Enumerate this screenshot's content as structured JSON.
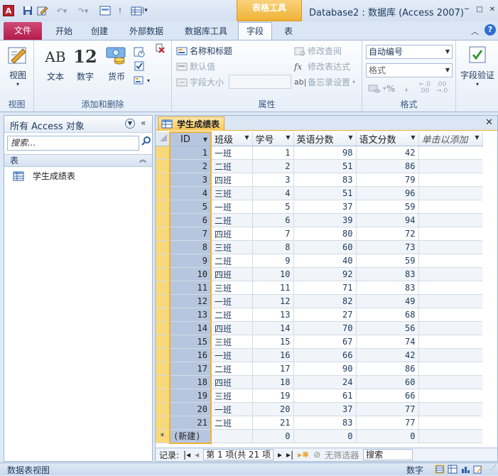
{
  "window": {
    "context_tab": "表格工具",
    "title": "Database2 : 数据库 (Access 2007)",
    "app_icon": "A",
    "controls": [
      "─",
      "□",
      "✕"
    ]
  },
  "ribbon_tabs": {
    "file": "文件",
    "items": [
      "开始",
      "创建",
      "外部数据",
      "数据库工具",
      "字段",
      "表"
    ],
    "active": "字段"
  },
  "ribbon": {
    "view": {
      "label": "视图",
      "group": "视图"
    },
    "add_delete": {
      "group": "添加和删除",
      "text": "文本",
      "number": "数字",
      "currency": "货币",
      "icon_text": "AB",
      "icon_number": "12"
    },
    "properties": {
      "group": "属性",
      "name_caption": "名称和标题",
      "default_value": "默认值",
      "field_size": "字段大小",
      "modify_lookups": "修改查阅",
      "modify_expression": "修改表达式",
      "memo_settings": "备忘录设置"
    },
    "format": {
      "group": "格式",
      "data_type": "自动编号",
      "format_value": "格式",
      "percent": "%",
      "comma": ",",
      "inc_decimal": "←.0 .00",
      "dec_decimal": ".00 →.0"
    },
    "validation": {
      "label": "字段验证"
    }
  },
  "nav_pane": {
    "header": "所有 Access 对象",
    "search_placeholder": "搜索...",
    "section": "表",
    "items": [
      "学生成绩表"
    ]
  },
  "document": {
    "tab_title": "学生成绩表",
    "columns": [
      "ID",
      "班级",
      "学号",
      "英语分数",
      "语文分数",
      "单击以添加"
    ],
    "rows": [
      [
        1,
        "一班",
        1,
        98,
        42
      ],
      [
        2,
        "二班",
        2,
        51,
        86
      ],
      [
        3,
        "四班",
        3,
        83,
        79
      ],
      [
        4,
        "三班",
        4,
        51,
        96
      ],
      [
        5,
        "一班",
        5,
        37,
        59
      ],
      [
        6,
        "二班",
        6,
        39,
        94
      ],
      [
        7,
        "四班",
        7,
        80,
        72
      ],
      [
        8,
        "三班",
        8,
        60,
        73
      ],
      [
        9,
        "二班",
        9,
        40,
        59
      ],
      [
        10,
        "四班",
        10,
        92,
        83
      ],
      [
        11,
        "三班",
        11,
        71,
        83
      ],
      [
        12,
        "一班",
        12,
        82,
        49
      ],
      [
        13,
        "二班",
        13,
        27,
        68
      ],
      [
        14,
        "四班",
        14,
        70,
        56
      ],
      [
        15,
        "三班",
        15,
        67,
        74
      ],
      [
        16,
        "一班",
        16,
        66,
        42
      ],
      [
        17,
        "二班",
        17,
        90,
        86
      ],
      [
        18,
        "四班",
        18,
        24,
        60
      ],
      [
        19,
        "三班",
        19,
        61,
        66
      ],
      [
        20,
        "一班",
        20,
        37,
        77
      ],
      [
        21,
        "二班",
        21,
        83,
        77
      ]
    ],
    "new_row": {
      "marker": "*",
      "label": "(新建)",
      "values": [
        0,
        0,
        0
      ]
    }
  },
  "record_nav": {
    "label": "记录:",
    "position": "第 1 项(共 21 项",
    "filter": "无筛选器",
    "search": "搜索"
  },
  "status": {
    "left": "数据表视图",
    "right": "数字"
  }
}
